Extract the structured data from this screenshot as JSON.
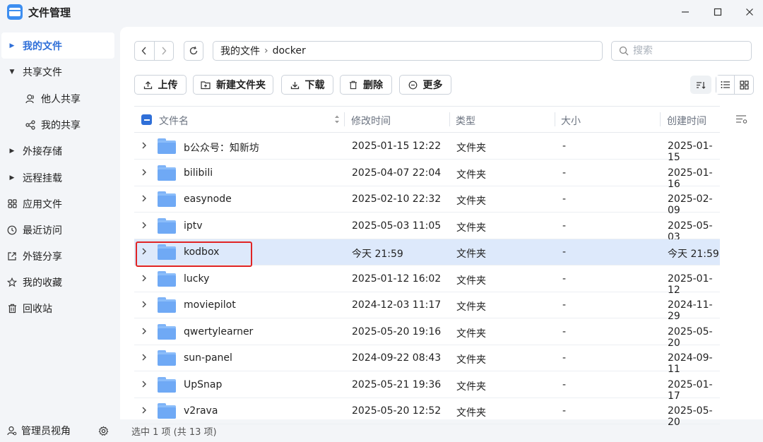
{
  "app": {
    "title": "文件管理"
  },
  "window_controls": {
    "minimize": "−",
    "maximize": "☐",
    "close": "✕"
  },
  "sidebar": {
    "items": [
      {
        "label": "我的文件",
        "name": "sidebar-item-my-files",
        "active": true,
        "icon": "caret-right"
      },
      {
        "label": "共享文件",
        "name": "sidebar-item-shared-files",
        "icon": "caret-down"
      },
      {
        "label": "他人共享",
        "name": "sidebar-item-shared-by-others",
        "icon": "people-icon",
        "sub": true
      },
      {
        "label": "我的共享",
        "name": "sidebar-item-my-shares",
        "icon": "share-icon",
        "sub": true
      },
      {
        "label": "外接存储",
        "name": "sidebar-item-external-storage",
        "icon": "caret-right"
      },
      {
        "label": "远程挂载",
        "name": "sidebar-item-remote-mount",
        "icon": "caret-right"
      },
      {
        "label": "应用文件",
        "name": "sidebar-item-app-files",
        "icon": "grid-icon"
      },
      {
        "label": "最近访问",
        "name": "sidebar-item-recent",
        "icon": "clock-icon"
      },
      {
        "label": "外链分享",
        "name": "sidebar-item-link-share",
        "icon": "external-share-icon"
      },
      {
        "label": "我的收藏",
        "name": "sidebar-item-favorites",
        "icon": "star-icon"
      },
      {
        "label": "回收站",
        "name": "sidebar-item-trash",
        "icon": "trash-icon"
      }
    ],
    "bottom": {
      "label": "管理员视角",
      "icon": "admin-icon",
      "settings_icon": "gear-icon"
    }
  },
  "toolbar": {
    "path": [
      "我的文件",
      "docker"
    ],
    "path_sep": "›",
    "search_placeholder": "搜索",
    "buttons": [
      {
        "label": "上传",
        "icon": "upload-icon"
      },
      {
        "label": "新建文件夹",
        "icon": "new-folder-icon"
      },
      {
        "label": "下载",
        "icon": "download-icon"
      },
      {
        "label": "删除",
        "icon": "trash-icon"
      },
      {
        "label": "更多",
        "icon": "more-icon"
      }
    ]
  },
  "table": {
    "headers": {
      "name": "文件名",
      "modified": "修改时间",
      "type": "类型",
      "size": "大小",
      "created": "创建时间"
    },
    "rows": [
      {
        "name": "b公众号：知新坊",
        "modified": "2025-01-15 12:22",
        "type": "文件夹",
        "size": "-",
        "created": "2025-01-15"
      },
      {
        "name": "bilibili",
        "modified": "2025-04-07 22:04",
        "type": "文件夹",
        "size": "-",
        "created": "2025-01-16"
      },
      {
        "name": "easynode",
        "modified": "2025-02-10 22:32",
        "type": "文件夹",
        "size": "-",
        "created": "2025-02-09"
      },
      {
        "name": "iptv",
        "modified": "2025-05-03 11:05",
        "type": "文件夹",
        "size": "-",
        "created": "2025-05-03"
      },
      {
        "name": "kodbox",
        "modified": "今天 21:59",
        "type": "文件夹",
        "size": "-",
        "created": "今天 21:59",
        "selected": true
      },
      {
        "name": "lucky",
        "modified": "2025-01-12 16:02",
        "type": "文件夹",
        "size": "-",
        "created": "2025-01-12"
      },
      {
        "name": "moviepilot",
        "modified": "2024-12-03 11:17",
        "type": "文件夹",
        "size": "-",
        "created": "2024-11-29"
      },
      {
        "name": "qwertylearner",
        "modified": "2025-05-20 19:16",
        "type": "文件夹",
        "size": "-",
        "created": "2025-05-20"
      },
      {
        "name": "sun-panel",
        "modified": "2024-09-22 08:43",
        "type": "文件夹",
        "size": "-",
        "created": "2024-09-11"
      },
      {
        "name": "UpSnap",
        "modified": "2025-05-21 19:36",
        "type": "文件夹",
        "size": "-",
        "created": "2025-01-17"
      },
      {
        "name": "v2rava",
        "modified": "2025-05-20 12:52",
        "type": "文件夹",
        "size": "-",
        "created": "2025-05-20"
      }
    ]
  },
  "status": {
    "text": "选中 1 项 (共 13 项)"
  },
  "colors": {
    "accent": "#2f6fd8",
    "selected_row": "#dde9fb",
    "highlight_box": "#e02424",
    "folder": "#6fa9f5"
  }
}
